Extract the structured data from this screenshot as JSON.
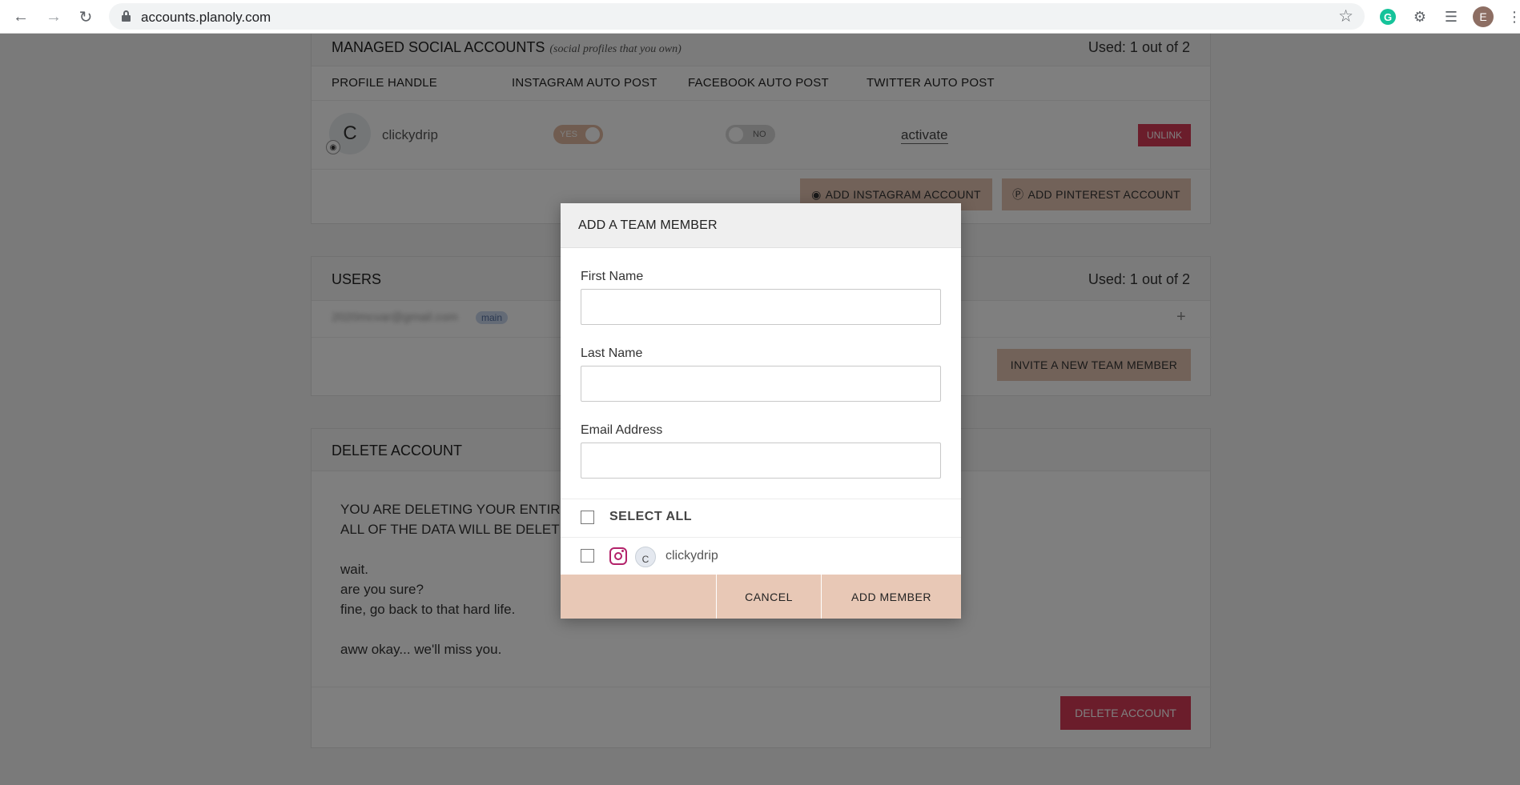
{
  "browser": {
    "url": "accounts.planoly.com",
    "avatar_letter": "E",
    "grammarly_letter": "G"
  },
  "managed_accounts": {
    "title": "MANAGED SOCIAL ACCOUNTS",
    "subtitle": "(social profiles that you own)",
    "used": "Used: 1 out of 2",
    "columns": [
      "PROFILE HANDLE",
      "INSTAGRAM AUTO POST",
      "FACEBOOK AUTO POST",
      "TWITTER AUTO POST"
    ],
    "profile_initial": "C",
    "profile_handle": "clickydrip",
    "instagram_toggle": "YES",
    "facebook_toggle": "NO",
    "twitter_link": "activate",
    "unlink_label": "UNLINK",
    "add_instagram_label": "ADD INSTAGRAM ACCOUNT",
    "add_pinterest_label": "ADD PINTEREST ACCOUNT"
  },
  "users": {
    "title": "USERS",
    "used": "Used: 1 out of 2",
    "user_email": "2020mcvar@gmail.com",
    "user_badge": "main",
    "expand_symbol": "+",
    "invite_label": "INVITE A NEW TEAM MEMBER"
  },
  "delete_account": {
    "title": "DELETE ACCOUNT",
    "line1": "YOU ARE DELETING YOUR ENTIRE P",
    "line2": "ALL OF THE DATA WILL BE DELETED",
    "line3": "wait.",
    "line4": "are you sure?",
    "line5": "fine, go back to that hard life.",
    "line6": "aww okay... we'll miss you.",
    "button_label": "DELETE ACCOUNT"
  },
  "modal": {
    "title": "ADD A TEAM MEMBER",
    "first_name_label": "First Name",
    "first_name_value": "",
    "last_name_label": "Last Name",
    "last_name_value": "",
    "email_label": "Email Address",
    "email_value": "",
    "select_all_label": "SELECT ALL",
    "account_initial": "C",
    "account_name": "clickydrip",
    "cancel_label": "CANCEL",
    "add_member_label": "ADD MEMBER"
  },
  "colors": {
    "accent_peach": "#e8c8b6",
    "danger_red": "#d63a56",
    "instagram": "#b3226a"
  }
}
